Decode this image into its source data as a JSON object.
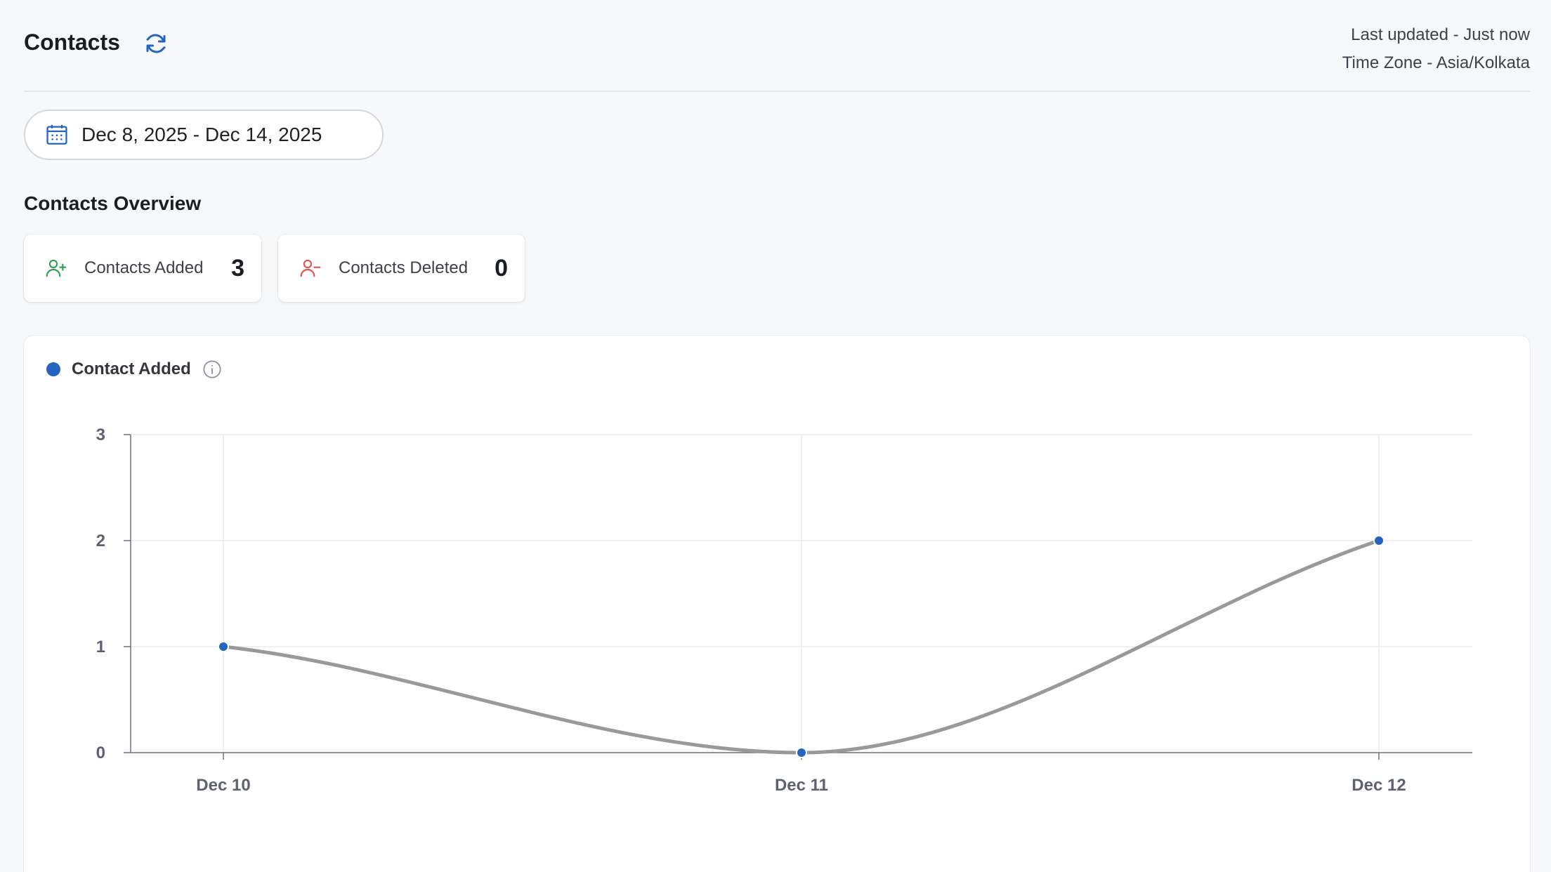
{
  "header": {
    "title": "Contacts",
    "refresh_icon": "refresh-icon",
    "last_updated": "Last updated - Just now",
    "time_zone": "Time Zone - Asia/Kolkata"
  },
  "date_range": {
    "icon": "calendar-icon",
    "label": "Dec 8, 2025 - Dec 14, 2025"
  },
  "overview": {
    "title": "Contacts Overview",
    "cards": [
      {
        "icon": "user-plus-icon",
        "label": "Contacts Added",
        "value": "3",
        "color": "#2e9e55"
      },
      {
        "icon": "user-minus-icon",
        "label": "Contacts Deleted",
        "value": "0",
        "color": "#e0524f"
      }
    ]
  },
  "colors": {
    "accent": "#2264c0",
    "line": "#999999",
    "grid": "#ececee"
  },
  "chart_data": {
    "type": "line",
    "title": "",
    "legend": "Contact Added",
    "legend_placement": "top-left",
    "categories": [
      "Dec 10",
      "Dec 11",
      "Dec 12"
    ],
    "series": [
      {
        "name": "Contact Added",
        "values": [
          1,
          0,
          2
        ]
      }
    ],
    "xlabel": "",
    "ylabel": "",
    "ylim": [
      0,
      3
    ],
    "yticks": [
      "0",
      "1",
      "2",
      "3"
    ],
    "grid": true,
    "smooth": true
  }
}
